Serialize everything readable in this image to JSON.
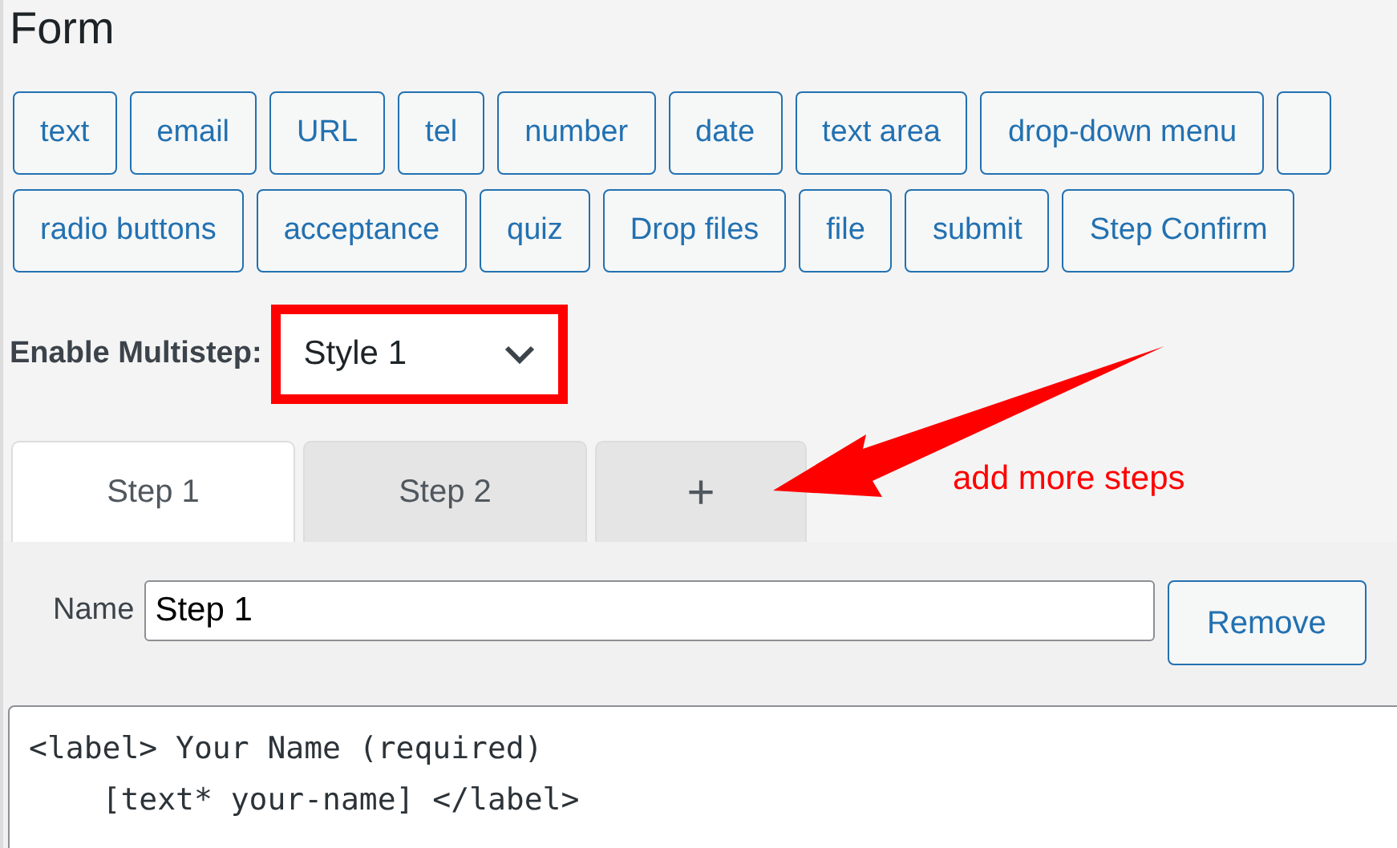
{
  "title": "Form",
  "tag_button_rows": [
    [
      "text",
      "email",
      "URL",
      "tel",
      "number",
      "date",
      "text area",
      "drop-down menu",
      ""
    ],
    [
      "radio buttons",
      "acceptance",
      "quiz",
      "Drop files",
      "file",
      "submit",
      "Step Confirm"
    ]
  ],
  "multistep": {
    "label": "Enable Multistep:",
    "value": "Style 1",
    "highlighted": true
  },
  "step_tabs": [
    {
      "kind": "step",
      "label": "Step 1",
      "selected": true
    },
    {
      "kind": "step",
      "label": "Step 2",
      "selected": false
    },
    {
      "kind": "add",
      "label": "+",
      "selected": false
    }
  ],
  "annotation": {
    "text": "add more steps"
  },
  "step_name": {
    "label": "Name",
    "value": "Step 1"
  },
  "remove_button": "Remove",
  "code_lines": [
    "<label> Your Name (required)",
    "    [text* your-name] </label>"
  ]
}
